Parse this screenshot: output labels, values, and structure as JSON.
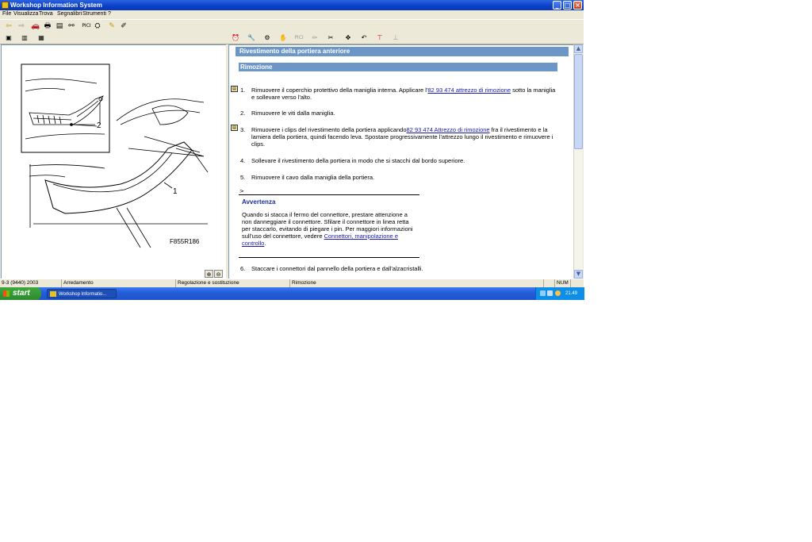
{
  "window": {
    "title": "Workshop Information System",
    "controls": {
      "minimize": "_",
      "maximize": "□",
      "close": "×"
    }
  },
  "menu": [
    "File",
    "Visualizza",
    "Trova",
    "Segnalibri",
    "Strumenti",
    "?"
  ],
  "toolbar": {
    "back_icon": "back-arrow-icon",
    "forward_icon": "forward-arrow-icon",
    "pici_label": "PICI"
  },
  "toolbar2": {
    "pici_label": "PICI"
  },
  "illustration": {
    "label_1": "1",
    "label_2": "2",
    "ref_code": "F855R186"
  },
  "document": {
    "header": "Rivestimento della portiera anteriore",
    "section": "Rimozione",
    "steps": [
      {
        "num": "1.",
        "pre": "Rimuovere il coperchio protettivo della maniglia interna. Applicare l'",
        "link": "82 93 474 attrezzo di rimozione",
        "post": " sotto la maniglia e sollevare verso l'alto."
      },
      {
        "num": "2.",
        "text": "Rimuovere le viti dalla maniglia."
      },
      {
        "num": "3.",
        "pre": "Rimuovere i clips del rivestimento della portiera applicando",
        "link": "82 93 474 Attrezzo di rimozione",
        "post": " fra il rivestimento e la lamiera della portiera, quindi facendo leva. Spostare progressivamente l'attrezzo lungo il rivestimento e rimuovere i clips."
      },
      {
        "num": "4.",
        "text": "Sollevare il rivestimento della portiera in modo che si stacchi dal bordo superiore."
      },
      {
        "num": "5.",
        "text": "Rimuovere il cavo dalla maniglia della portiera."
      },
      {
        "num": "6.",
        "text": "Staccare i connettori dal pannello della portiera e dall'alzacristalli."
      }
    ],
    "marker": ">",
    "warning": {
      "title": "Avvertenza",
      "body": "Quando si stacca il fermo del connettore, prestare attenzione a non danneggiare il connettore. Sfilare il connettore in linea retta per staccarlo, evitando di piegare i pin. Per maggiori informazioni sull'uso del connettore, vedere ",
      "link": "Connettori, manipolazione e controllo",
      "end": "."
    }
  },
  "statusbar": [
    "9-3 (9440) 2003",
    "Arredamento",
    "Regolazione e sostituzione",
    "Rimozione",
    "",
    "NUM",
    ""
  ],
  "taskbar": {
    "start": "start",
    "task": "Workshop Informatio...",
    "clock": "21.49"
  },
  "colors": {
    "header_blue": "#6c96c8",
    "link": "#1b1ba8",
    "warning_title": "#1b2f9a"
  }
}
